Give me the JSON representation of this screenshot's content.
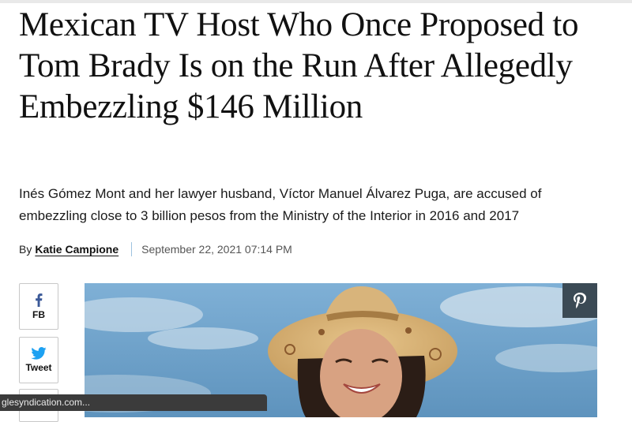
{
  "article": {
    "headline": "Mexican TV Host Who Once Proposed to Tom Brady Is on the Run After Allegedly Embezzling $146 Million",
    "dek": "Inés Gómez Mont and her lawyer husband, Víctor Manuel Álvarez Puga, are accused of embezzling close to 3 billion pesos from the Ministry of the Interior in 2016 and 2017",
    "byline": {
      "by": "By",
      "author": "Katie Campione",
      "date": "September 22, 2021 07:14 PM"
    }
  },
  "share": {
    "facebook_label": "FB",
    "twitter_label": "Tweet"
  },
  "hero": {
    "pin_icon": "pinterest-icon"
  },
  "statusbar": {
    "text": "glesyndication.com..."
  },
  "colors": {
    "facebook": "#3b5998",
    "twitter": "#1da1f2",
    "pin_bg": "#3b4a55",
    "separator": "#9ec3e0"
  }
}
